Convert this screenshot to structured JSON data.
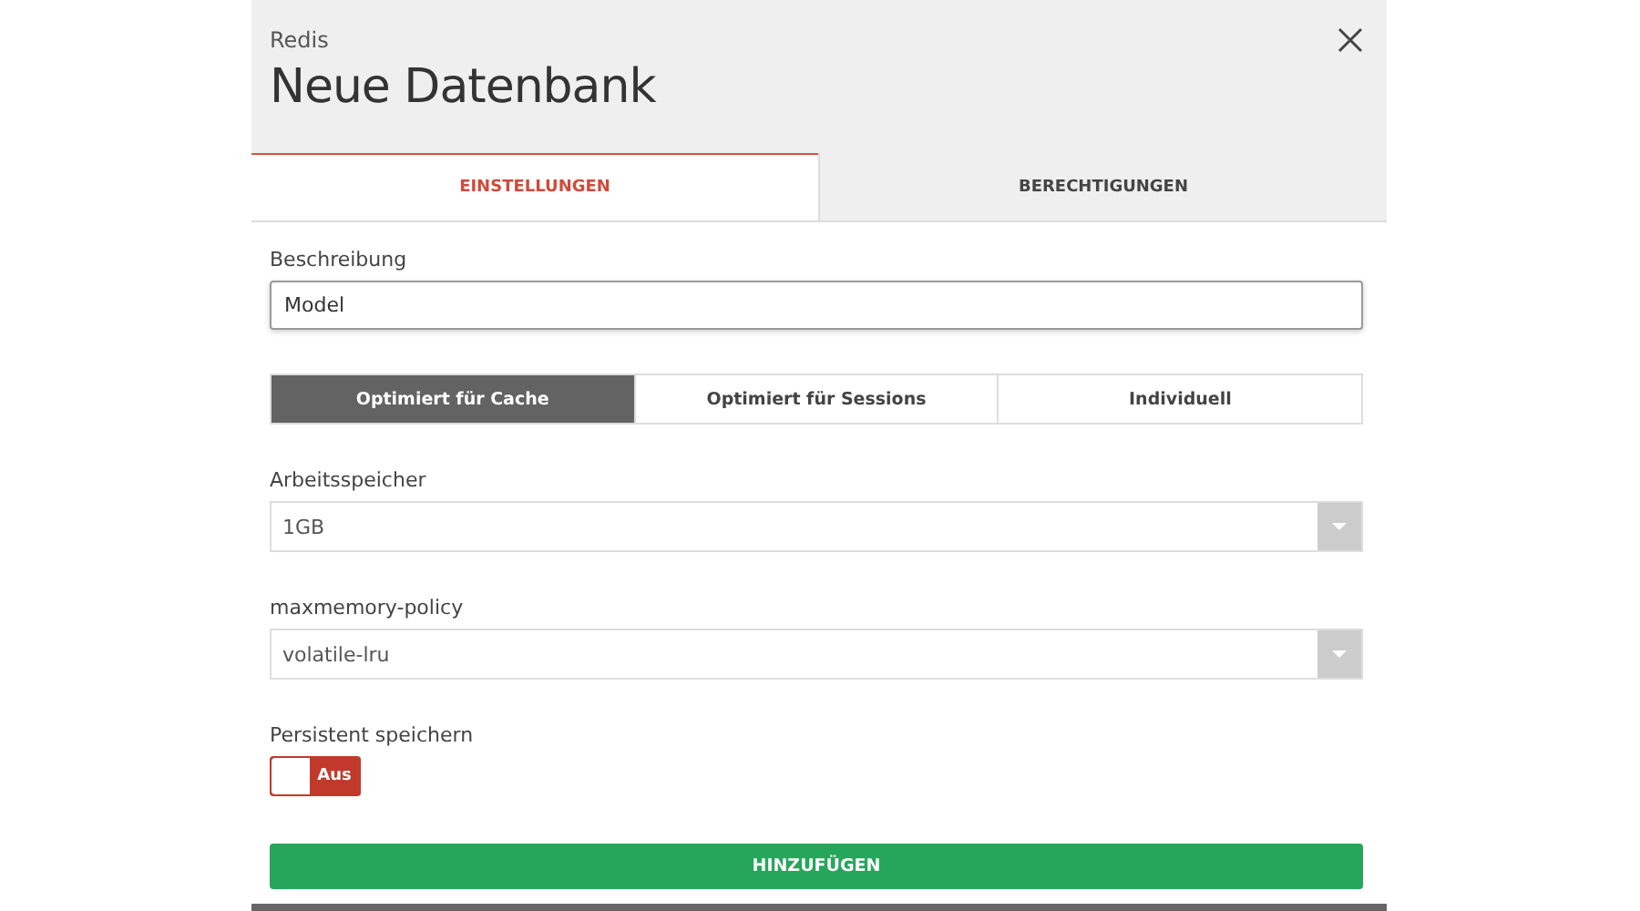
{
  "dialog": {
    "subtitle": "Redis",
    "title": "Neue Datenbank"
  },
  "tabs": [
    {
      "label": "EINSTELLUNGEN",
      "selected": true
    },
    {
      "label": "BERECHTIGUNGEN",
      "selected": false
    }
  ],
  "description": {
    "label": "Beschreibung",
    "value": "Model"
  },
  "presets": [
    {
      "label": "Optimiert für Cache",
      "selected": true
    },
    {
      "label": "Optimiert für Sessions",
      "selected": false
    },
    {
      "label": "Individuell",
      "selected": false
    }
  ],
  "selects": [
    {
      "label": "Arbeitsspeicher",
      "value": "1GB"
    },
    {
      "label": "maxmemory-policy",
      "value": "volatile-lru"
    }
  ],
  "persist": {
    "label": "Persistent speichern",
    "on": false,
    "state_label": "Aus"
  },
  "submit": "HINZUFÜGEN"
}
